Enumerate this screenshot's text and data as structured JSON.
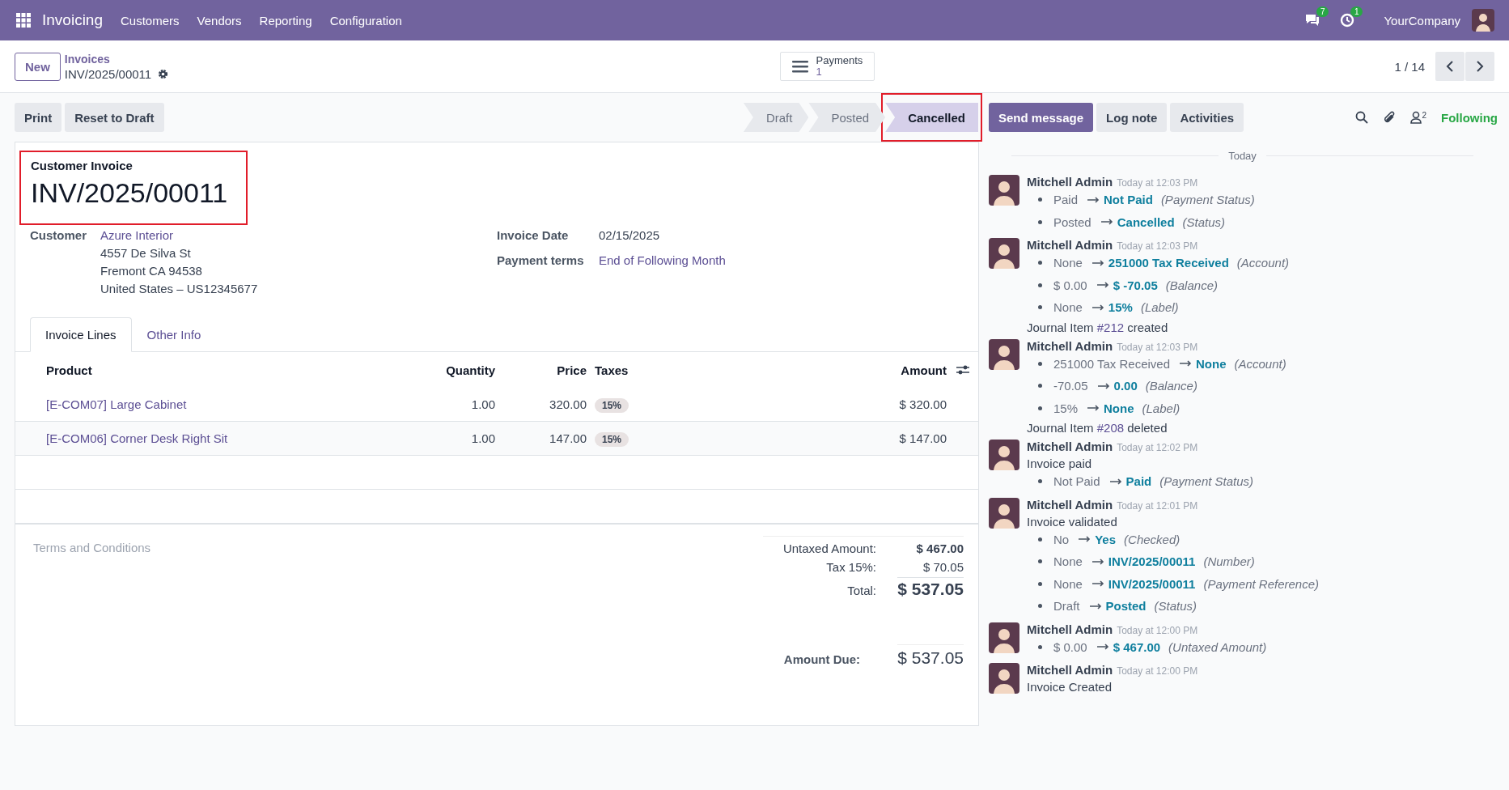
{
  "navbar": {
    "app": "Invoicing",
    "menu": [
      "Customers",
      "Vendors",
      "Reporting",
      "Configuration"
    ],
    "messages_badge": "7",
    "activities_badge": "1",
    "company": "YourCompany"
  },
  "control_panel": {
    "new_button": "New",
    "breadcrumb": "Invoices",
    "record": "INV/2025/00011",
    "stat_button": {
      "label": "Payments",
      "value": "1"
    },
    "pager": "1 / 14"
  },
  "actions": [
    "Print",
    "Reset to Draft"
  ],
  "stages": [
    {
      "label": "Draft",
      "selected": false,
      "highlighted": false
    },
    {
      "label": "Posted",
      "selected": false,
      "highlighted": false
    },
    {
      "label": "Cancelled",
      "selected": true,
      "highlighted": true
    }
  ],
  "chatter_buttons": [
    {
      "label": "Send message",
      "primary": true
    },
    {
      "label": "Log note",
      "primary": false
    },
    {
      "label": "Activities",
      "primary": false
    }
  ],
  "followers_count": "2",
  "follow_label": "Following",
  "form": {
    "heading": "Customer Invoice",
    "title": "INV/2025/00011",
    "title_highlighted": true,
    "customer": {
      "label": "Customer",
      "name": "Azure Interior",
      "address": [
        "4557 De Silva St",
        "Fremont CA 94538",
        "United States – US12345677"
      ]
    },
    "fields": [
      {
        "label": "Invoice Date",
        "value": "02/15/2025",
        "link": false
      },
      {
        "label": "Payment terms",
        "value": "End of Following Month",
        "link": true
      }
    ],
    "tabs": [
      {
        "label": "Invoice Lines",
        "selected": true
      },
      {
        "label": "Other Info",
        "selected": false
      }
    ],
    "table": {
      "columns": [
        "Product",
        "Quantity",
        "Price",
        "Taxes",
        "Amount"
      ],
      "rows": [
        {
          "product": "[E-COM07] Large Cabinet",
          "quantity": "1.00",
          "price": "320.00",
          "taxes": "15%",
          "amount": "$ 320.00"
        },
        {
          "product": "[E-COM06] Corner Desk Right Sit",
          "quantity": "1.00",
          "price": "147.00",
          "taxes": "15%",
          "amount": "$ 147.00"
        }
      ]
    },
    "terms_placeholder": "Terms and Conditions",
    "totals": [
      {
        "label": "Untaxed Amount:",
        "value": "$ 467.00",
        "kind": "subtotal"
      },
      {
        "label": "Tax 15%:",
        "value": "$ 70.05",
        "kind": "tax"
      },
      {
        "label": "Total:",
        "value": "$ 537.05",
        "kind": "total"
      }
    ],
    "amount_due": {
      "label": "Amount Due:",
      "value": "$ 537.05"
    }
  },
  "chatter": {
    "date_separator": "Today",
    "messages": [
      {
        "author": "Mitchell Admin",
        "time": "Today at 12:03 PM",
        "changes": [
          {
            "old": "Paid",
            "new": "Not Paid",
            "field": "(Payment Status)"
          },
          {
            "old": "Posted",
            "new": "Cancelled",
            "field": "(Status)"
          }
        ]
      },
      {
        "author": "Mitchell Admin",
        "time": "Today at 12:03 PM",
        "changes": [
          {
            "old": "None",
            "new": "251000 Tax Received",
            "field": "(Account)"
          },
          {
            "old": "$ 0.00",
            "new": "$ -70.05",
            "field": "(Balance)"
          },
          {
            "old": "None",
            "new": "15%",
            "field": "(Label)"
          }
        ],
        "note": {
          "before": "Journal Item",
          "link": "#212",
          "after": "created"
        }
      },
      {
        "author": "Mitchell Admin",
        "time": "Today at 12:03 PM",
        "changes": [
          {
            "old": "251000 Tax Received",
            "new": "None",
            "field": "(Account)"
          },
          {
            "old": "-70.05",
            "new": "0.00",
            "field": "(Balance)"
          },
          {
            "old": "15%",
            "new": "None",
            "field": "(Label)"
          }
        ],
        "note": {
          "before": "Journal Item",
          "link": "#208",
          "after": "deleted"
        }
      },
      {
        "author": "Mitchell Admin",
        "time": "Today at 12:02 PM",
        "body": "Invoice paid",
        "changes": [
          {
            "old": "Not Paid",
            "new": "Paid",
            "field": "(Payment Status)"
          }
        ]
      },
      {
        "author": "Mitchell Admin",
        "time": "Today at 12:01 PM",
        "body": "Invoice validated",
        "changes": [
          {
            "old": "No",
            "new": "Yes",
            "field": "(Checked)"
          },
          {
            "old": "None",
            "new": "INV/2025/00011",
            "field": "(Number)"
          },
          {
            "old": "None",
            "new": "INV/2025/00011",
            "field": "(Payment Reference)"
          },
          {
            "old": "Draft",
            "new": "Posted",
            "field": "(Status)"
          }
        ]
      },
      {
        "author": "Mitchell Admin",
        "time": "Today at 12:00 PM",
        "changes": [
          {
            "old": "$ 0.00",
            "new": "$ 467.00",
            "field": "(Untaxed Amount)"
          }
        ]
      },
      {
        "author": "Mitchell Admin",
        "time": "Today at 12:00 PM",
        "body": "Invoice Created"
      }
    ]
  }
}
